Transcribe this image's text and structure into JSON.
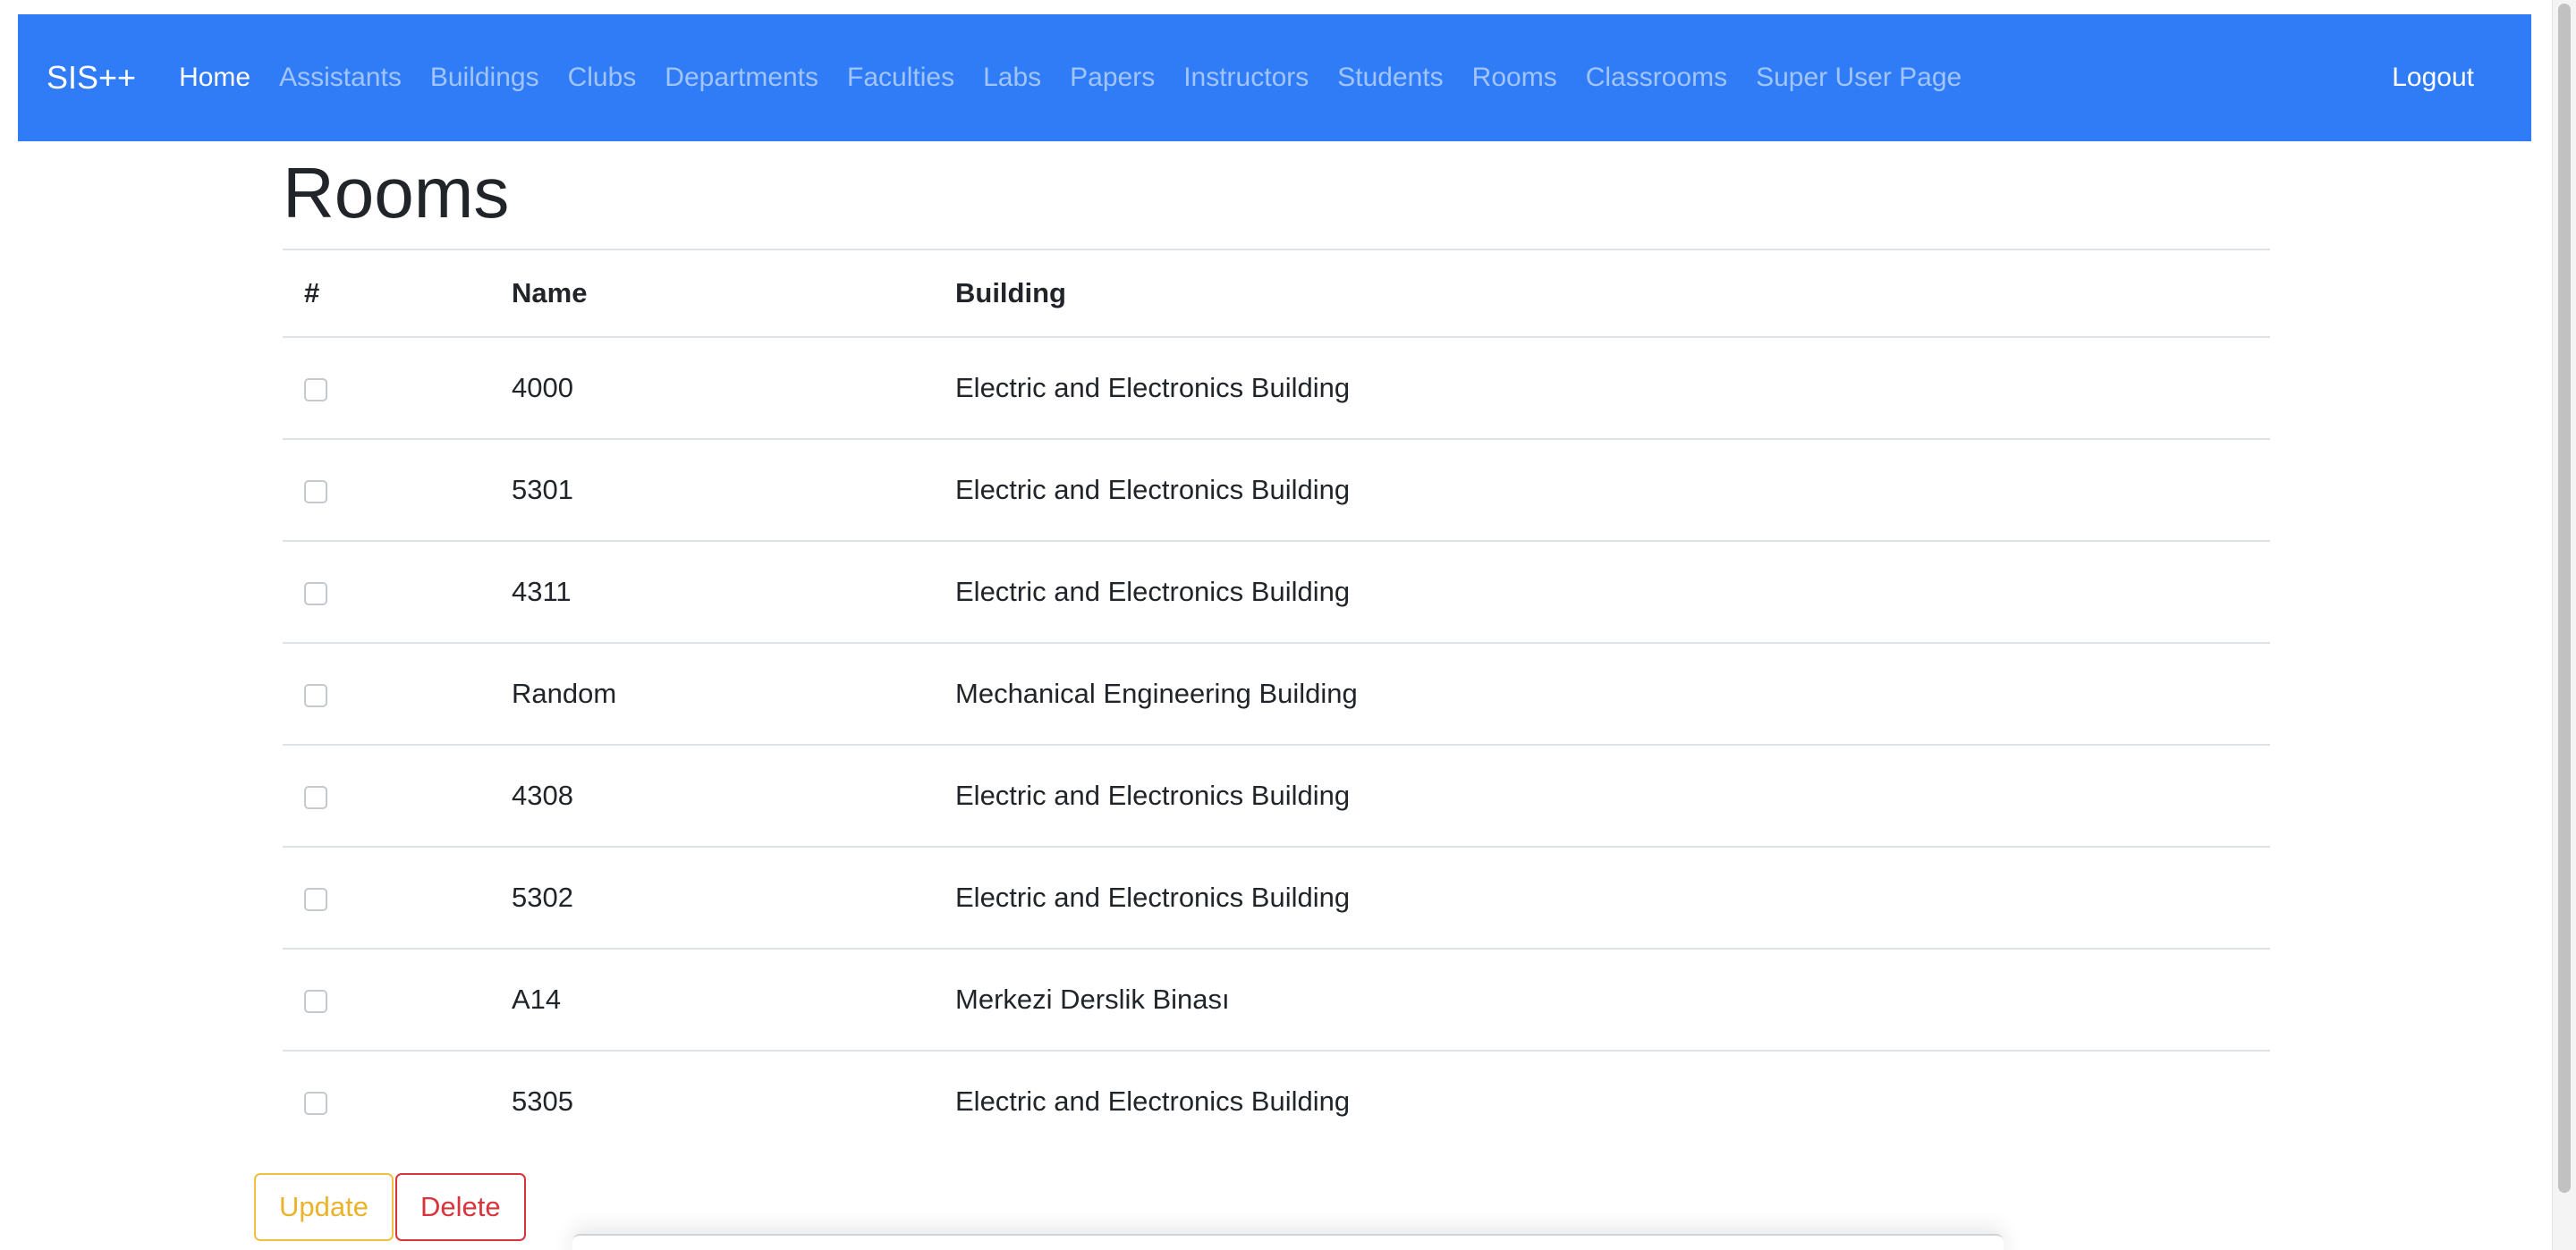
{
  "navbar": {
    "brand": "SIS++",
    "links": [
      {
        "label": "Home",
        "active": true
      },
      {
        "label": "Assistants"
      },
      {
        "label": "Buildings"
      },
      {
        "label": "Clubs"
      },
      {
        "label": "Departments"
      },
      {
        "label": "Faculties"
      },
      {
        "label": "Labs"
      },
      {
        "label": "Papers"
      },
      {
        "label": "Instructors"
      },
      {
        "label": "Students"
      },
      {
        "label": "Rooms"
      },
      {
        "label": "Classrooms"
      },
      {
        "label": "Super User Page"
      }
    ],
    "logout": "Logout",
    "color": "#2f7cf6"
  },
  "main": {
    "title": "Rooms",
    "table": {
      "headers": [
        "#",
        "Name",
        "Building"
      ],
      "rows": [
        {
          "checked": false,
          "name": "4000",
          "building": "Electric and Electronics Building"
        },
        {
          "checked": false,
          "name": "5301",
          "building": "Electric and Electronics Building"
        },
        {
          "checked": false,
          "name": "4311",
          "building": "Electric and Electronics Building"
        },
        {
          "checked": false,
          "name": "Random",
          "building": "Mechanical Engineering Building"
        },
        {
          "checked": false,
          "name": "4308",
          "building": "Electric and Electronics Building"
        },
        {
          "checked": false,
          "name": "5302",
          "building": "Electric and Electronics Building"
        },
        {
          "checked": false,
          "name": "A14",
          "building": "Merkezi Derslik Binası"
        },
        {
          "checked": false,
          "name": "5305",
          "building": "Electric and Electronics Building"
        }
      ]
    },
    "actions": {
      "update": "Update",
      "delete": "Delete"
    }
  }
}
